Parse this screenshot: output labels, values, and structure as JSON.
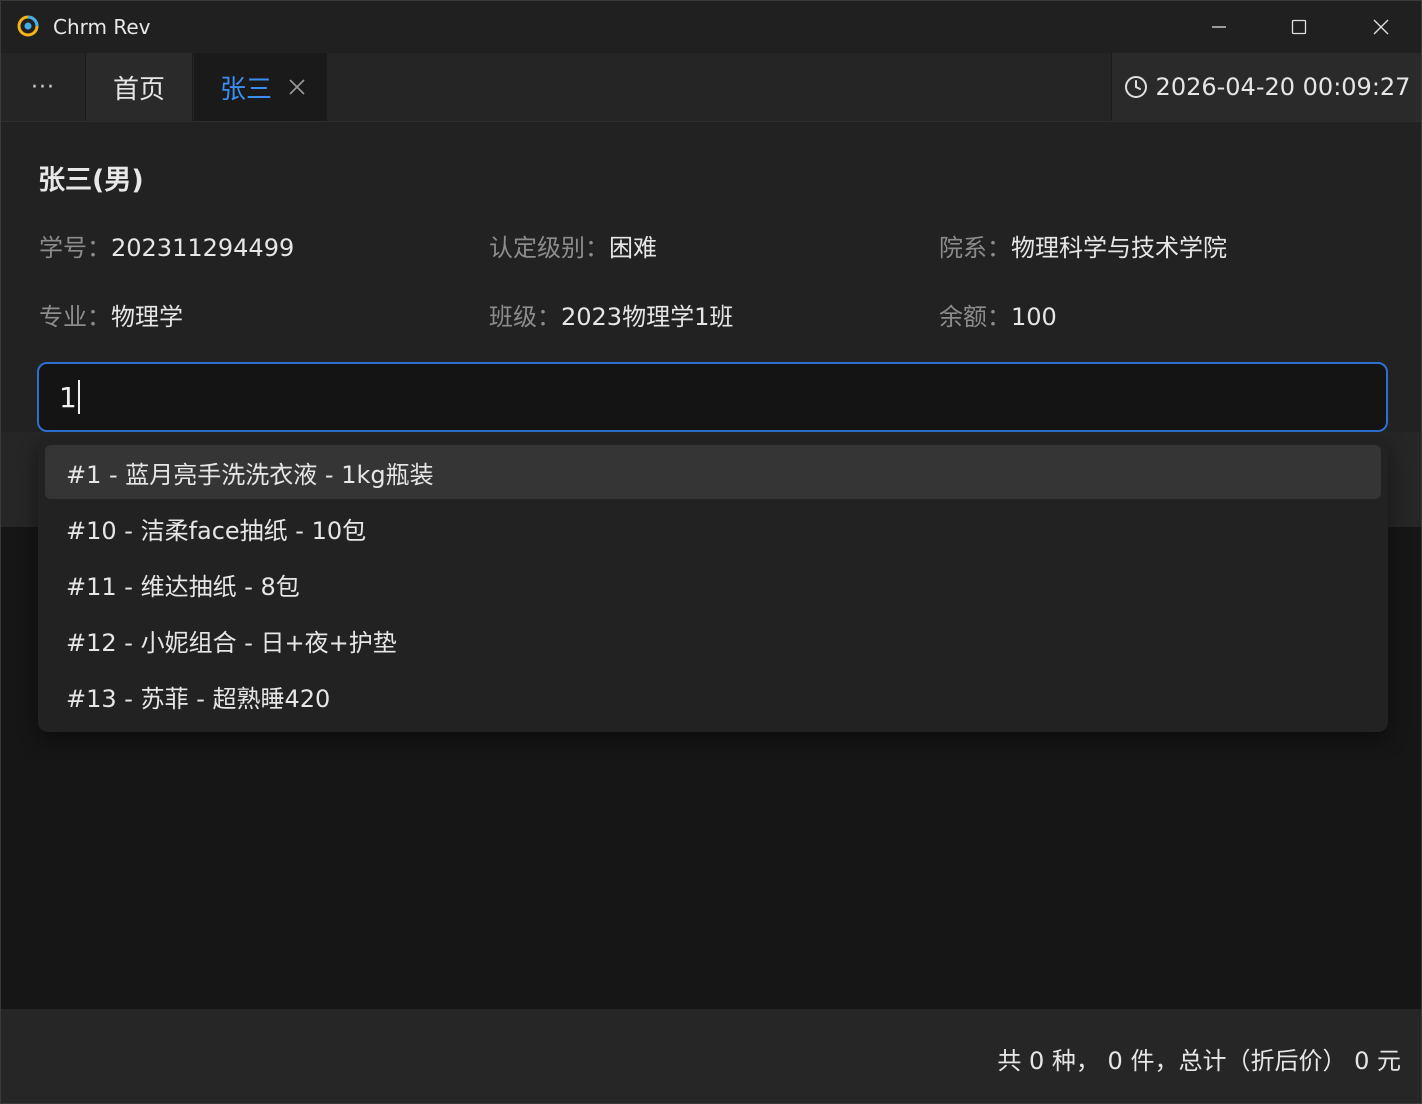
{
  "window": {
    "title": "Chrm Rev",
    "controls": [
      "minimize",
      "maximize",
      "close"
    ]
  },
  "tabs": {
    "more_label": "···",
    "items": [
      {
        "label": "首页",
        "active": false
      },
      {
        "label": "张三",
        "active": true,
        "closable": true
      }
    ],
    "clock": "2026-04-20 00:09:27"
  },
  "student": {
    "name": "张三(男)",
    "fields": {
      "student_id": {
        "label": "学号：",
        "value": "202311294499"
      },
      "level": {
        "label": "认定级别：",
        "value": "困难"
      },
      "department": {
        "label": "院系：",
        "value": "物理科学与技术学院"
      },
      "major": {
        "label": "专业：",
        "value": "物理学"
      },
      "class": {
        "label": "班级：",
        "value": "2023物理学1班"
      },
      "balance": {
        "label": "余额：",
        "value": "100"
      }
    }
  },
  "search": {
    "value": "1"
  },
  "dropdown": {
    "items": [
      {
        "label": "#1 - 蓝月亮手洗洗衣液 - 1kg瓶装",
        "highlighted": true
      },
      {
        "label": "#10 - 洁柔face抽纸 - 10包"
      },
      {
        "label": "#11 - 维达抽纸 - 8包"
      },
      {
        "label": "#12 - 小妮组合 - 日+夜+护垫"
      },
      {
        "label": "#13 - 苏菲 - 超熟睡420"
      }
    ]
  },
  "footer": {
    "summary": "共 0 种， 0 件，总计（折后价） 0 元"
  },
  "colors": {
    "accent": "#3b8ef0",
    "input_border": "#2f6fd0"
  }
}
